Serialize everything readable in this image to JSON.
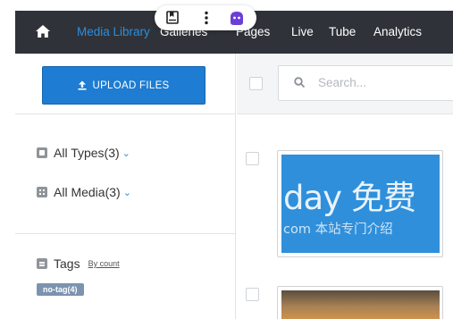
{
  "nav": {
    "items": [
      "Media Library",
      "Galleries",
      "Pages",
      "Live",
      "Tube",
      "Analytics"
    ],
    "active_color": "#2a8fe0"
  },
  "toolbar": {
    "icons": [
      "bookmark-icon",
      "more-vertical-icon",
      "extension-icon"
    ]
  },
  "sidebar": {
    "upload_label": "UPLOAD FILES",
    "filter_types": "All Types(3)",
    "filter_media": "All Media(3)",
    "tags_heading": "Tags",
    "tags_sort": "By count",
    "tag_badge": "no-tag(4)"
  },
  "main": {
    "search_placeholder": "Search...",
    "item1_text_big": "day 免费",
    "item1_text_small": "com 本站专门介绍"
  },
  "colors": {
    "topbar": "#2f3238",
    "accent": "#1e7cd2",
    "badge": "#7b93b0"
  }
}
